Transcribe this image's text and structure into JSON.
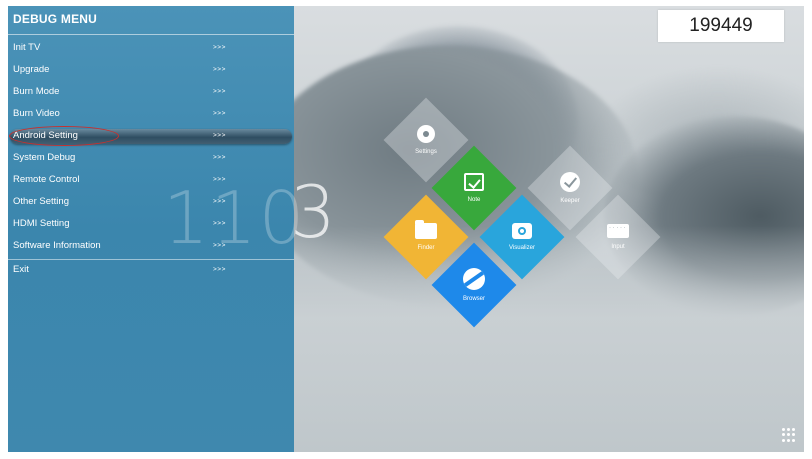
{
  "debug_menu": {
    "title": "DEBUG MENU",
    "items": [
      {
        "label": "Init TV",
        "arrow": ">>>"
      },
      {
        "label": "Upgrade",
        "arrow": ">>>"
      },
      {
        "label": "Burn Mode",
        "arrow": ">>>"
      },
      {
        "label": "Burn Video",
        "arrow": ">>>"
      },
      {
        "label": "Android Setting",
        "arrow": ">>>"
      },
      {
        "label": "System Debug",
        "arrow": ">>>"
      },
      {
        "label": "Remote Control",
        "arrow": ">>>"
      },
      {
        "label": "Other Setting",
        "arrow": ">>>"
      },
      {
        "label": "HDMI Setting",
        "arrow": ">>>"
      },
      {
        "label": "Software Information",
        "arrow": ">>>"
      },
      {
        "label": "Exit",
        "arrow": ">>>"
      }
    ],
    "selected_item": "Android Setting"
  },
  "code_display": "199449",
  "clock": {
    "text_faded": "110",
    "text_visible": "3"
  },
  "launcher": {
    "tiles": [
      {
        "label": "Settings",
        "icon": "gear-icon"
      },
      {
        "label": "Note",
        "icon": "note-icon",
        "color": "#38a83c"
      },
      {
        "label": "Keeper",
        "icon": "keeper-icon"
      },
      {
        "label": "Finder",
        "icon": "folder-icon",
        "color": "#f1b535"
      },
      {
        "label": "Visualizer",
        "icon": "camera-icon",
        "color": "#29a5dc"
      },
      {
        "label": "Input",
        "icon": "keyboard-icon"
      },
      {
        "label": "Browser",
        "icon": "planet-icon",
        "color": "#1e89ea"
      }
    ]
  },
  "apps_button_icon": "apps-grid-icon",
  "colors": {
    "panel": "#3f88ae",
    "selection_circle": "#c8302e"
  }
}
